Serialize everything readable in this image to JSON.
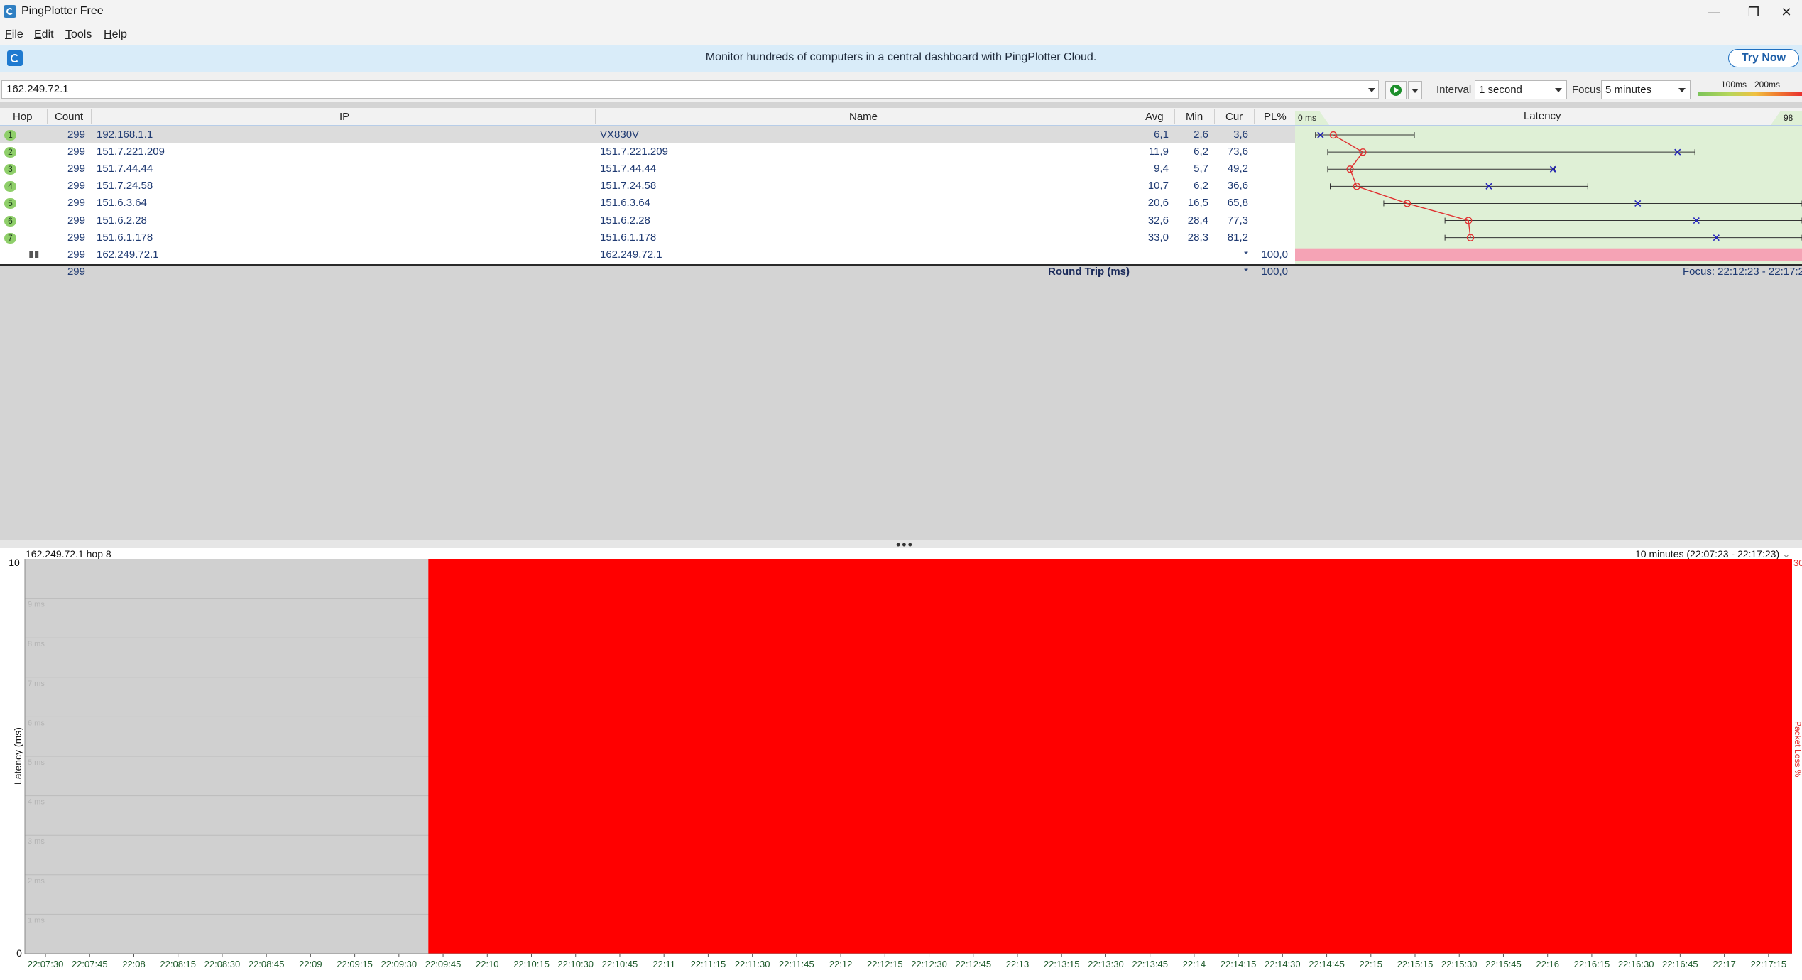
{
  "window": {
    "title": "PingPlotter Free",
    "controls": [
      "—",
      "❐",
      "✕"
    ]
  },
  "menu": [
    "File",
    "Edit",
    "Tools",
    "Help"
  ],
  "banner": {
    "text": "Monitor hundreds of computers in a central dashboard with PingPlotter Cloud.",
    "button": "Try Now"
  },
  "toolbar": {
    "target": "162.249.72.1",
    "interval_label": "Interval",
    "interval_value": "1 second",
    "focus_label": "Focus",
    "focus_value": "5 minutes",
    "scale_100": "100ms",
    "scale_200": "200ms"
  },
  "grid": {
    "columns": {
      "hop": "Hop",
      "count": "Count",
      "ip": "IP",
      "name": "Name",
      "avg": "Avg",
      "min": "Min",
      "cur": "Cur",
      "pl": "PL%",
      "latency": "Latency"
    },
    "rows": [
      {
        "hop": "1",
        "count": "299",
        "ip": "192.168.1.1",
        "name": "VX830V",
        "avg": "6,1",
        "min": "2,6",
        "cur": "3,6",
        "pl": "",
        "min_ms": 2.6,
        "avg_ms": 6.1,
        "cur_ms": 3.6,
        "max_ms": 22
      },
      {
        "hop": "2",
        "count": "299",
        "ip": "151.7.221.209",
        "name": "151.7.221.209",
        "avg": "11,9",
        "min": "6,2",
        "cur": "73,6",
        "pl": "",
        "min_ms": 5,
        "avg_ms": 11.9,
        "cur_ms": 73.6,
        "max_ms": 77
      },
      {
        "hop": "3",
        "count": "299",
        "ip": "151.7.44.44",
        "name": "151.7.44.44",
        "avg": "9,4",
        "min": "5,7",
        "cur": "49,2",
        "pl": "",
        "min_ms": 5,
        "avg_ms": 9.4,
        "cur_ms": 49.2,
        "max_ms": 49.5
      },
      {
        "hop": "4",
        "count": "299",
        "ip": "151.7.24.58",
        "name": "151.7.24.58",
        "avg": "10,7",
        "min": "6,2",
        "cur": "36,6",
        "pl": "",
        "min_ms": 5.5,
        "avg_ms": 10.7,
        "cur_ms": 36.6,
        "max_ms": 56
      },
      {
        "hop": "5",
        "count": "299",
        "ip": "151.6.3.64",
        "name": "151.6.3.64",
        "avg": "20,6",
        "min": "16,5",
        "cur": "65,8",
        "pl": "",
        "min_ms": 16,
        "avg_ms": 20.6,
        "cur_ms": 65.8,
        "max_ms": 98
      },
      {
        "hop": "6",
        "count": "299",
        "ip": "151.6.2.28",
        "name": "151.6.2.28",
        "avg": "32,6",
        "min": "28,4",
        "cur": "77,3",
        "pl": "",
        "min_ms": 28,
        "avg_ms": 32.6,
        "cur_ms": 77.3,
        "max_ms": 98
      },
      {
        "hop": "7",
        "count": "299",
        "ip": "151.6.1.178",
        "name": "151.6.1.178",
        "avg": "33,0",
        "min": "28,3",
        "cur": "81,2",
        "pl": "",
        "min_ms": 28,
        "avg_ms": 33.0,
        "cur_ms": 81.2,
        "max_ms": 98
      },
      {
        "hop": "",
        "count": "299",
        "ip": "162.249.72.1",
        "name": "162.249.72.1",
        "avg": "",
        "min": "",
        "cur": "*",
        "pl": "100,0",
        "lost": true
      }
    ],
    "summary": {
      "count": "299",
      "label": "Round Trip (ms)",
      "cur": "*",
      "pl": "100,0",
      "focus": "Focus: 22:12:23 - 22:17:23"
    },
    "latency_axis": {
      "left": "0 ms",
      "right": "98 ms",
      "max": 98
    }
  },
  "graph": {
    "label": "162.249.72.1 hop 8",
    "range": "10 minutes (22:07:23 - 22:17:23)",
    "ylabel": "Latency (ms)",
    "right_label": "Packet Loss %",
    "right_top": "30",
    "y_top": "10",
    "y_bottom": "0",
    "y_ticks": [
      "9 ms",
      "8 ms",
      "7 ms",
      "6 ms",
      "5 ms",
      "4 ms",
      "3 ms",
      "2 ms",
      "1 ms"
    ],
    "x_ticks": [
      "22:07:30",
      "22:07:45",
      "22:08",
      "22:08:15",
      "22:08:30",
      "22:08:45",
      "22:09",
      "22:09:15",
      "22:09:30",
      "22:09:45",
      "22:10",
      "22:10:15",
      "22:10:30",
      "22:10:45",
      "22:11",
      "22:11:15",
      "22:11:30",
      "22:11:45",
      "22:12",
      "22:12:15",
      "22:12:30",
      "22:12:45",
      "22:13",
      "22:13:15",
      "22:13:30",
      "22:13:45",
      "22:14",
      "22:14:15",
      "22:14:30",
      "22:14:45",
      "22:15",
      "22:15:15",
      "22:15:30",
      "22:15:45",
      "22:16",
      "22:16:15",
      "22:16:30",
      "22:16:45",
      "22:17",
      "22:17:15"
    ],
    "start_sec": 0,
    "end_sec": 600,
    "loss_start_sec": 137,
    "loss_color": "#ff0000"
  },
  "colors": {
    "latency_bg": "#dff0d6",
    "loss_row": "#f5a3b5",
    "avg_line": "#e03030",
    "cur_marker": "#2222bb"
  }
}
